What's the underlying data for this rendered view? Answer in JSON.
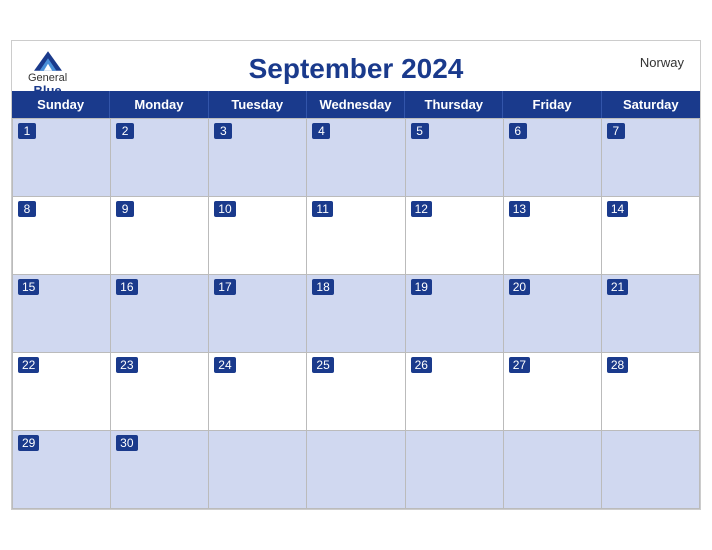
{
  "header": {
    "month_year": "September 2024",
    "country": "Norway",
    "logo_general": "General",
    "logo_blue": "Blue"
  },
  "days_of_week": [
    "Sunday",
    "Monday",
    "Tuesday",
    "Wednesday",
    "Thursday",
    "Friday",
    "Saturday"
  ],
  "weeks": [
    [
      {
        "num": "1",
        "shaded": true
      },
      {
        "num": "2",
        "shaded": true
      },
      {
        "num": "3",
        "shaded": true
      },
      {
        "num": "4",
        "shaded": true
      },
      {
        "num": "5",
        "shaded": true
      },
      {
        "num": "6",
        "shaded": true
      },
      {
        "num": "7",
        "shaded": true
      }
    ],
    [
      {
        "num": "8",
        "shaded": false
      },
      {
        "num": "9",
        "shaded": false
      },
      {
        "num": "10",
        "shaded": false
      },
      {
        "num": "11",
        "shaded": false
      },
      {
        "num": "12",
        "shaded": false
      },
      {
        "num": "13",
        "shaded": false
      },
      {
        "num": "14",
        "shaded": false
      }
    ],
    [
      {
        "num": "15",
        "shaded": true
      },
      {
        "num": "16",
        "shaded": true
      },
      {
        "num": "17",
        "shaded": true
      },
      {
        "num": "18",
        "shaded": true
      },
      {
        "num": "19",
        "shaded": true
      },
      {
        "num": "20",
        "shaded": true
      },
      {
        "num": "21",
        "shaded": true
      }
    ],
    [
      {
        "num": "22",
        "shaded": false
      },
      {
        "num": "23",
        "shaded": false
      },
      {
        "num": "24",
        "shaded": false
      },
      {
        "num": "25",
        "shaded": false
      },
      {
        "num": "26",
        "shaded": false
      },
      {
        "num": "27",
        "shaded": false
      },
      {
        "num": "28",
        "shaded": false
      }
    ],
    [
      {
        "num": "29",
        "shaded": true
      },
      {
        "num": "30",
        "shaded": true
      },
      {
        "num": "",
        "shaded": true
      },
      {
        "num": "",
        "shaded": true
      },
      {
        "num": "",
        "shaded": true
      },
      {
        "num": "",
        "shaded": true
      },
      {
        "num": "",
        "shaded": true
      }
    ]
  ]
}
